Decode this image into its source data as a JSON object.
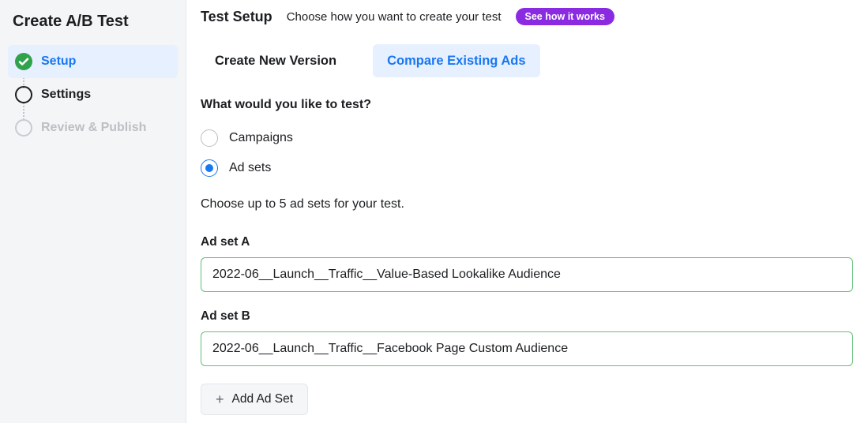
{
  "sidebar": {
    "title": "Create A/B Test",
    "steps": [
      {
        "label": "Setup",
        "state": "active"
      },
      {
        "label": "Settings",
        "state": "pending"
      },
      {
        "label": "Review & Publish",
        "state": "dim"
      }
    ]
  },
  "header": {
    "title": "Test Setup",
    "subtitle": "Choose how you want to create your test",
    "pill_label": "See how it works"
  },
  "subtabs": [
    {
      "label": "Create New Version",
      "active": false
    },
    {
      "label": "Compare Existing Ads",
      "active": true
    }
  ],
  "question": "What would you like to test?",
  "radio_options": [
    {
      "label": "Campaigns",
      "selected": false
    },
    {
      "label": "Ad sets",
      "selected": true
    }
  ],
  "helper_text": "Choose up to 5 ad sets for your test.",
  "adsets": [
    {
      "group_label": "Ad set A",
      "value": "2022-06__Launch__Traffic__Value-Based Lookalike Audience"
    },
    {
      "group_label": "Ad set B",
      "value": "2022-06__Launch__Traffic__Facebook Page Custom Audience"
    }
  ],
  "add_button_label": "Add Ad Set",
  "colors": {
    "accent": "#1877f2",
    "pill": "#8a2be2",
    "select_border": "#63be7b",
    "success": "#31a24c"
  }
}
